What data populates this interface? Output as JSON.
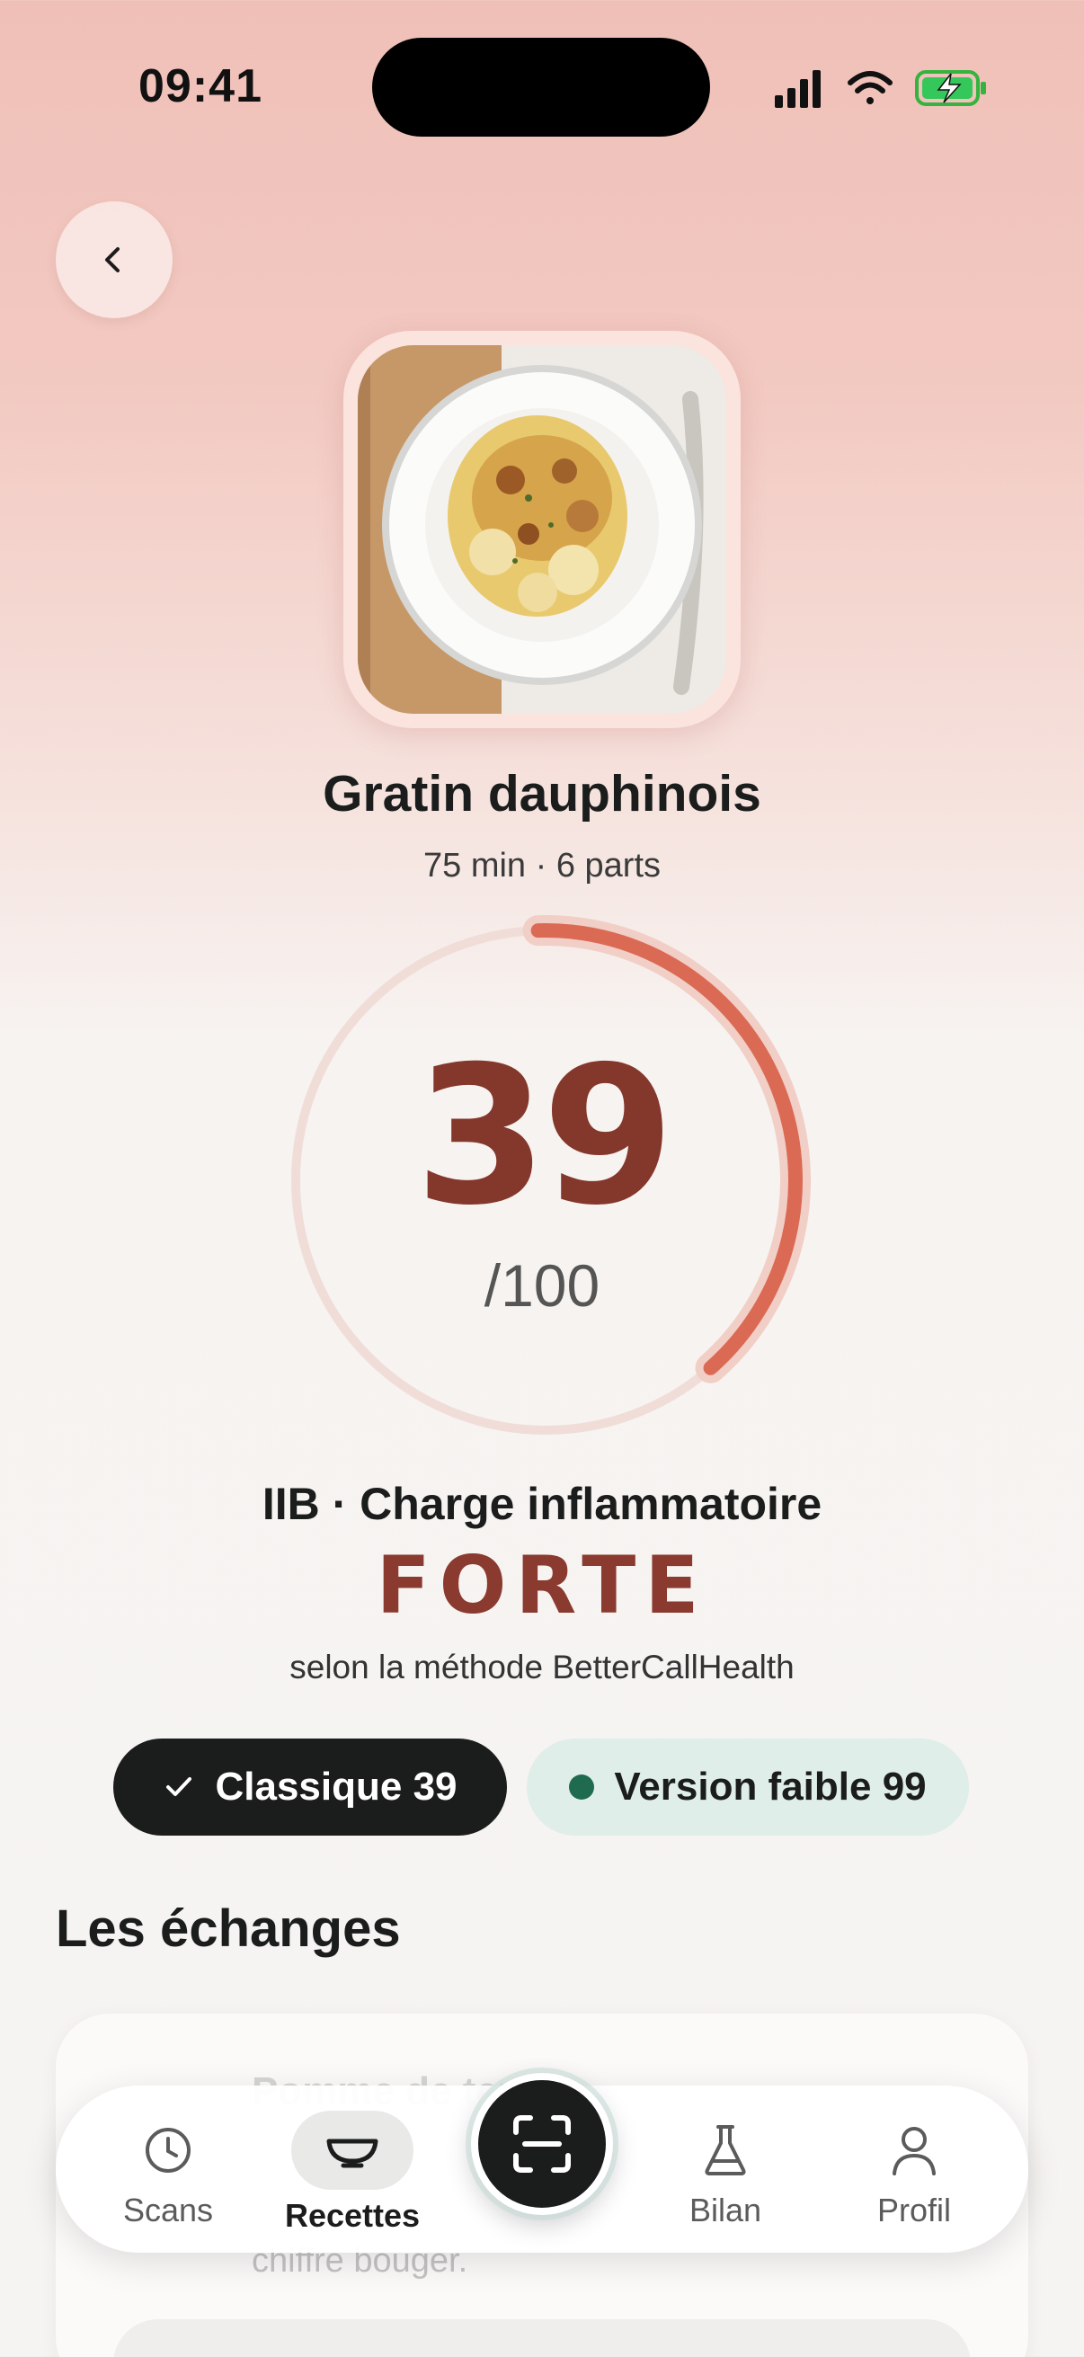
{
  "status_bar": {
    "time": "09:41"
  },
  "back_button": {
    "icon": "chevron-left-icon"
  },
  "dish": {
    "title": "Gratin dauphinois",
    "meta": "75 min · 6 parts"
  },
  "score": {
    "value": "39",
    "max": "/100",
    "fraction": 0.39,
    "accent_color": "#db6a55",
    "value_color": "#84372b"
  },
  "rating": {
    "label": "IIB · Charge inflammatoire",
    "level": "FORTE",
    "note": "selon la méthode BetterCallHealth"
  },
  "chips": {
    "classic": "Classique 39",
    "light": "Version faible 99"
  },
  "section": {
    "title": "Les échanges"
  },
  "card": {
    "title": "Pomme de terre",
    "text": "chiffre bouger."
  },
  "tabs": [
    {
      "label": "Scans",
      "icon": "clock-icon"
    },
    {
      "label": "Recettes",
      "icon": "bowl-icon",
      "active": true
    },
    {
      "label": "Bilan",
      "icon": "flask-icon"
    },
    {
      "label": "Profil",
      "icon": "person-icon"
    }
  ],
  "scan_button": {
    "icon": "scan-icon"
  }
}
